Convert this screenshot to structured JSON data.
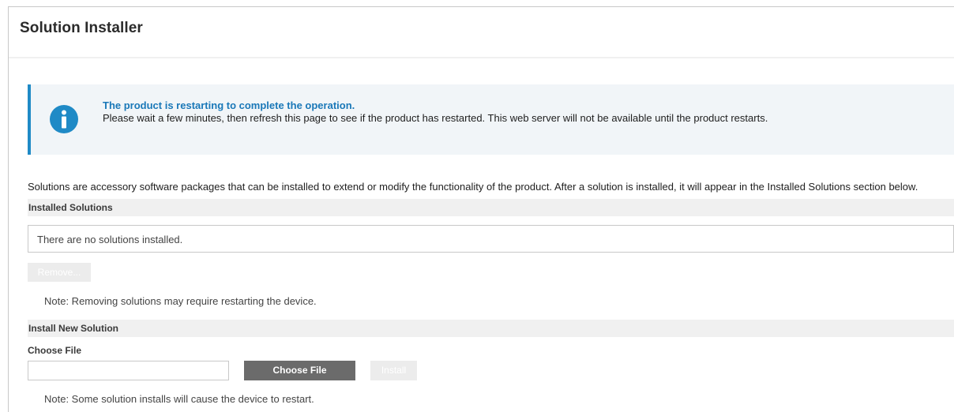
{
  "page": {
    "title": "Solution Installer"
  },
  "alert": {
    "icon": "info-icon",
    "title": "The product is restarting to complete the operation.",
    "body": "Please wait a few minutes, then refresh this page to see if the product has restarted. This web server will not be available until the product restarts."
  },
  "intro": "Solutions are accessory software packages that can be installed to extend or modify the functionality of the product. After a solution is installed, it will appear in the Installed Solutions section below.",
  "installed": {
    "header": "Installed Solutions",
    "empty_text": "There are no solutions installed.",
    "remove_label": "Remove...",
    "note": "Note: Removing solutions may require restarting the device."
  },
  "install_new": {
    "header": "Install New Solution",
    "choose_label": "Choose File",
    "file_value": "",
    "choose_button_label": "Choose File",
    "install_label": "Install",
    "note": "Note: Some solution installs will cause the device to restart."
  },
  "colors": {
    "accent": "#1f8ac6",
    "alert_title": "#1a78b8",
    "alert_bg": "#f1f5f8",
    "section_bg": "#f0f0f0",
    "button_dark": "#6b6b6b",
    "button_disabled": "#ececec"
  }
}
